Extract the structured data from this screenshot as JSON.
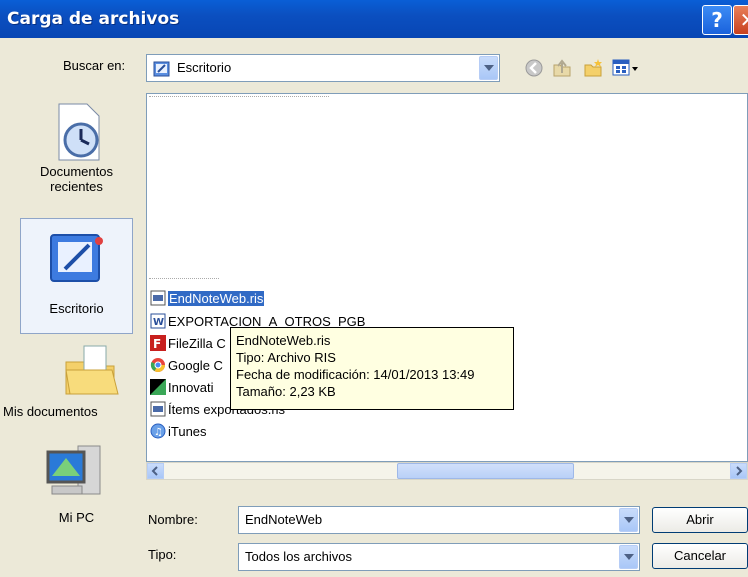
{
  "window": {
    "title": "Carga de archivos"
  },
  "lookin": {
    "label": "Buscar en:",
    "value": "Escritorio"
  },
  "places": [
    {
      "label_line1": "Documentos",
      "label_line2": "recientes"
    },
    {
      "label_line1": "Escritorio",
      "label_line2": ""
    },
    {
      "label_line1": "Mis documentos",
      "label_line2": ""
    },
    {
      "label_line1": "Mi PC",
      "label_line2": ""
    }
  ],
  "files": [
    {
      "name": "EndNoteWeb.ris",
      "icon": "ris-file-icon"
    },
    {
      "name": "EXPORTACION_A_OTROS_PGB",
      "icon": "word-doc-icon"
    },
    {
      "name": "FileZilla C",
      "icon": "filezilla-icon"
    },
    {
      "name": "Google C",
      "icon": "chrome-icon"
    },
    {
      "name": "Innovati",
      "icon": "shortcut-icon"
    },
    {
      "name": "Ítems exportados.ris",
      "icon": "ris-file-icon"
    },
    {
      "name": "iTunes",
      "icon": "itunes-icon"
    }
  ],
  "tooltip": {
    "line1": "EndNoteWeb.ris",
    "line2": "Tipo: Archivo RIS",
    "line3": "Fecha de modificación: 14/01/2013 13:49",
    "line4": "Tamaño: 2,23 KB"
  },
  "filename": {
    "label": "Nombre:",
    "value": "EndNoteWeb"
  },
  "filetype": {
    "label": "Tipo:",
    "value": "Todos los archivos"
  },
  "buttons": {
    "open": "Abrir",
    "cancel": "Cancelar"
  },
  "colors": {
    "titlebar": "#0a5fd6",
    "selection": "#316ac5",
    "tooltip_bg": "#ffffe1",
    "dialog_bg": "#ece9d8"
  }
}
